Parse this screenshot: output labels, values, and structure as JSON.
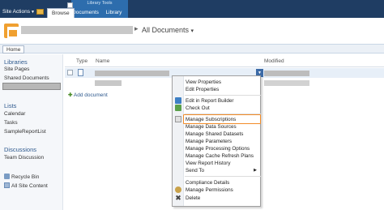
{
  "ribbon": {
    "site_actions": "Site Actions",
    "tabs": {
      "browse": "Browse"
    },
    "library_tools": {
      "title": "Library Tools",
      "tabs": [
        "Documents",
        "Library"
      ]
    }
  },
  "header": {
    "page_title": "All Documents"
  },
  "topbar": {
    "home": "Home"
  },
  "quick_launch": {
    "libraries_heading": "Libraries",
    "library_items": [
      "Site Pages",
      "Shared Documents"
    ],
    "lists_heading": "Lists",
    "list_items": [
      "Calendar",
      "Tasks",
      "SampleReportList"
    ],
    "discussions_heading": "Discussions",
    "discussion_items": [
      "Team Discussion"
    ],
    "bottom_items": [
      "Recycle Bin",
      "All Site Content"
    ]
  },
  "list": {
    "columns": {
      "type": "Type",
      "name": "Name",
      "modified": "Modified"
    },
    "add_document": "Add document"
  },
  "context_menu": {
    "groups": [
      [
        "View Properties",
        "Edit Properties"
      ],
      [
        "Edit in Report Builder",
        "Check Out"
      ],
      [
        "Manage Subscriptions",
        "Manage Data Sources",
        "Manage Shared Datasets",
        "Manage Parameters",
        "Manage Processing Options",
        "Manage Cache Refresh Plans",
        "View Report History",
        "Send To"
      ],
      [
        "Compliance Details",
        "Manage Permissions",
        "Delete"
      ]
    ],
    "highlighted": "Manage Subscriptions"
  },
  "colors": {
    "ribbon": "#1f3d63",
    "library_tools": "#2d6dad",
    "link": "#2f5a8e",
    "highlight": "#f28c28"
  }
}
